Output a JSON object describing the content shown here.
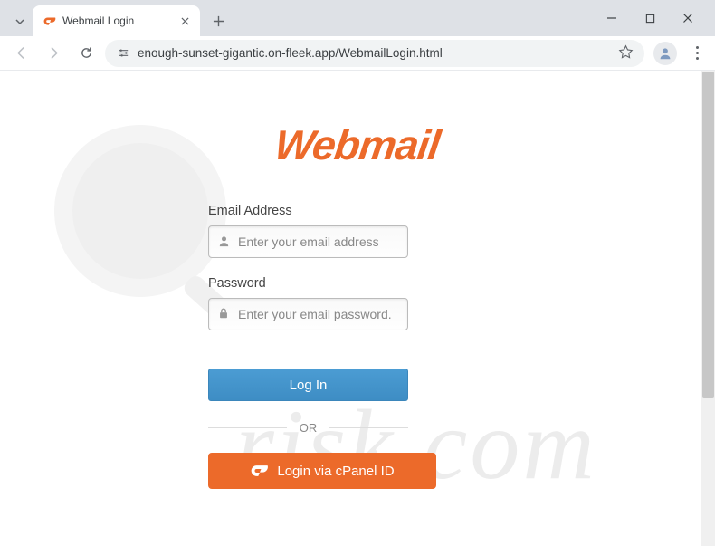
{
  "browser": {
    "tab_title": "Webmail Login",
    "url": "enough-sunset-gigantic.on-fleek.app/WebmailLogin.html"
  },
  "page": {
    "logo_text": "Webmail",
    "email_label": "Email Address",
    "email_placeholder": "Enter your email address",
    "password_label": "Password",
    "password_placeholder": "Enter your email password.",
    "login_button": "Log In",
    "divider_text": "OR",
    "cpanel_button": "Login via cPanel ID"
  },
  "watermark": {
    "text": "risk.com"
  },
  "colors": {
    "accent_orange": "#ec6a2a",
    "accent_blue": "#4b9cd3"
  }
}
